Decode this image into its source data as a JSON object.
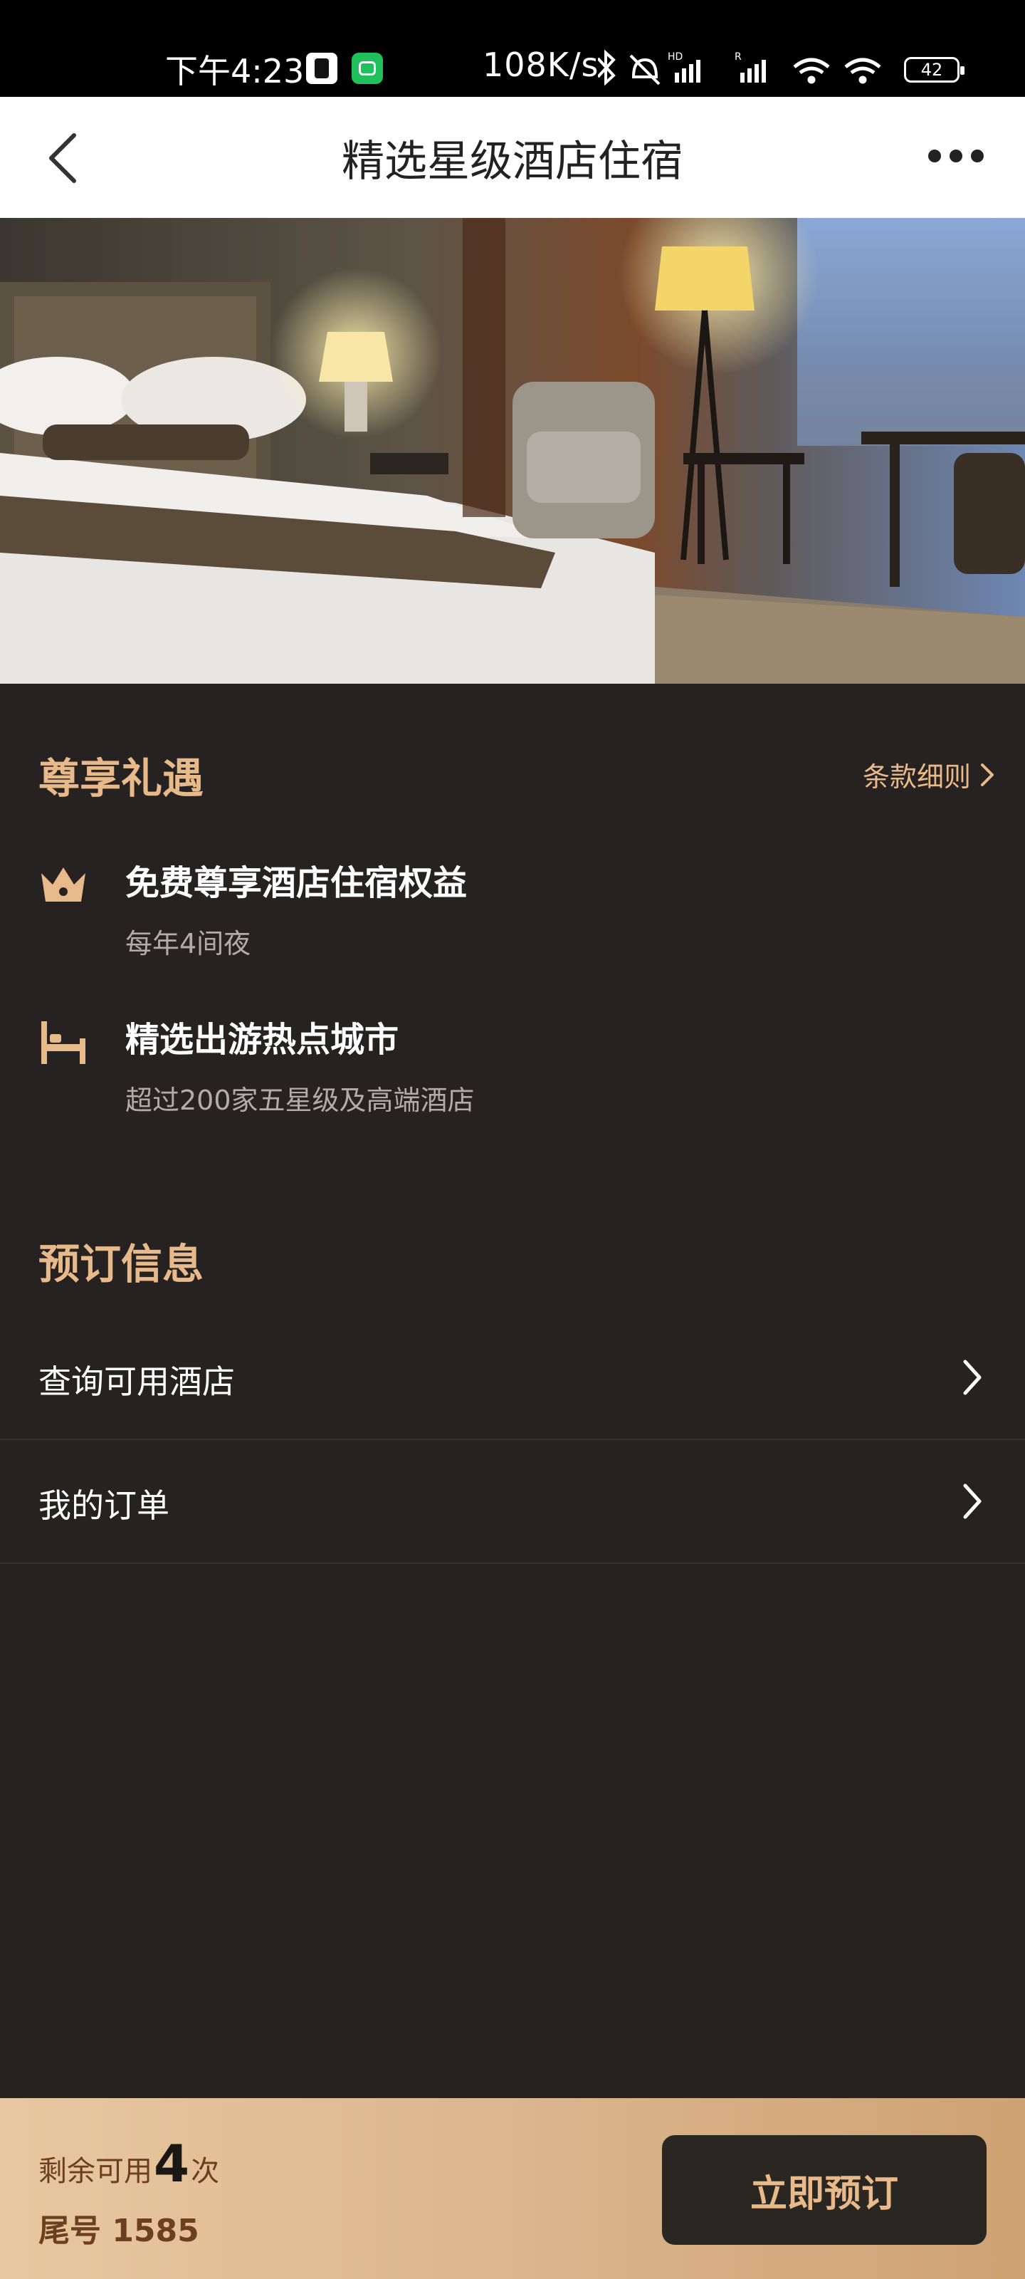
{
  "status_bar": {
    "time": "下午4:23",
    "network_speed": "108K/s",
    "battery": "42"
  },
  "nav": {
    "title": "精选星级酒店住宿"
  },
  "benefits": {
    "section_title": "尊享礼遇",
    "terms_label": "条款细则",
    "items": [
      {
        "title": "免费尊享酒店住宿权益",
        "subtitle": "每年4间夜",
        "icon": "crown-icon"
      },
      {
        "title": "精选出游热点城市",
        "subtitle": "超过200家五星级及高端酒店",
        "icon": "bed-icon"
      }
    ]
  },
  "booking": {
    "section_title": "预订信息",
    "rows": [
      {
        "label": "查询可用酒店"
      },
      {
        "label": "我的订单"
      }
    ]
  },
  "bottom": {
    "remain_prefix": "剩余可用",
    "remain_count": "4",
    "remain_suffix": "次",
    "tail_number": "尾号 1585",
    "book_button": "立即预订"
  },
  "colors": {
    "accent": "#e8b989",
    "background": "#262222"
  }
}
